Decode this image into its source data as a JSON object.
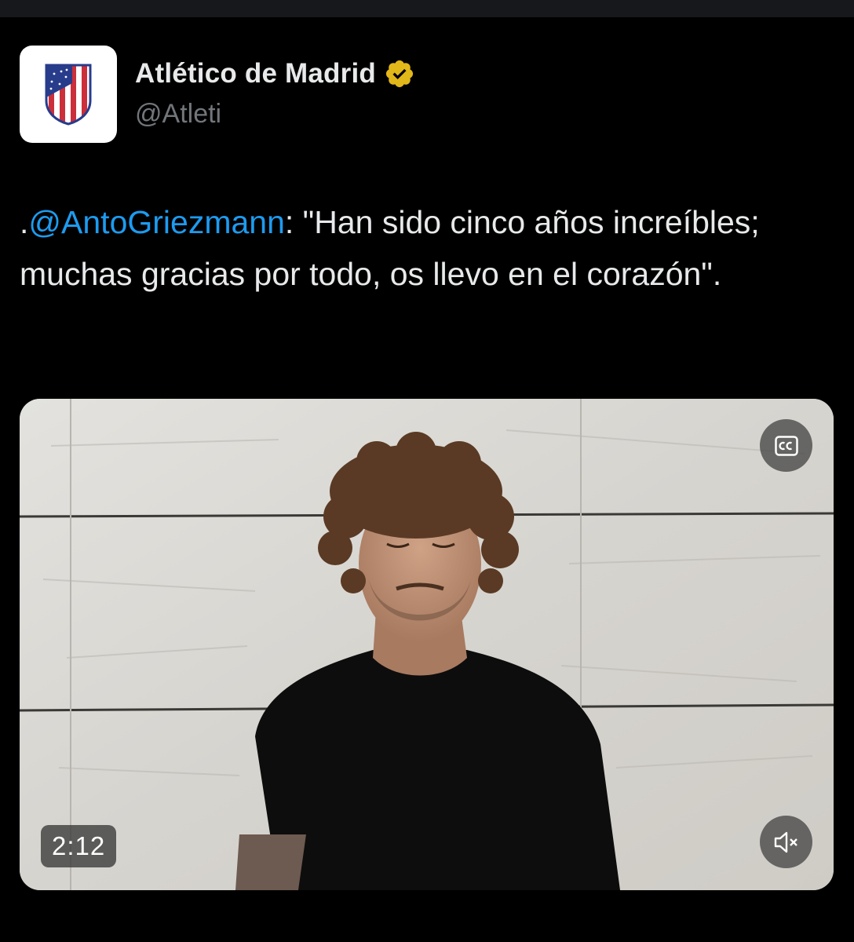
{
  "account": {
    "display_name": "Atlético de Madrid",
    "handle": "@Atleti",
    "verified": true,
    "avatar_icon": "atletico-crest-icon"
  },
  "tweet": {
    "prefix": ".",
    "mention": "@AntoGriezmann",
    "text": ": \"Han sido cinco años increíbles; muchas gracias por todo, os llevo en el corazón\"."
  },
  "video": {
    "duration": "2:12",
    "captions_icon": "cc-icon",
    "mute_icon": "speaker-muted-icon"
  },
  "colors": {
    "background": "#000000",
    "text": "#e7e9ea",
    "secondary_text": "#71767b",
    "mention": "#1d9bf0",
    "verified_badge": "#e2b719"
  }
}
